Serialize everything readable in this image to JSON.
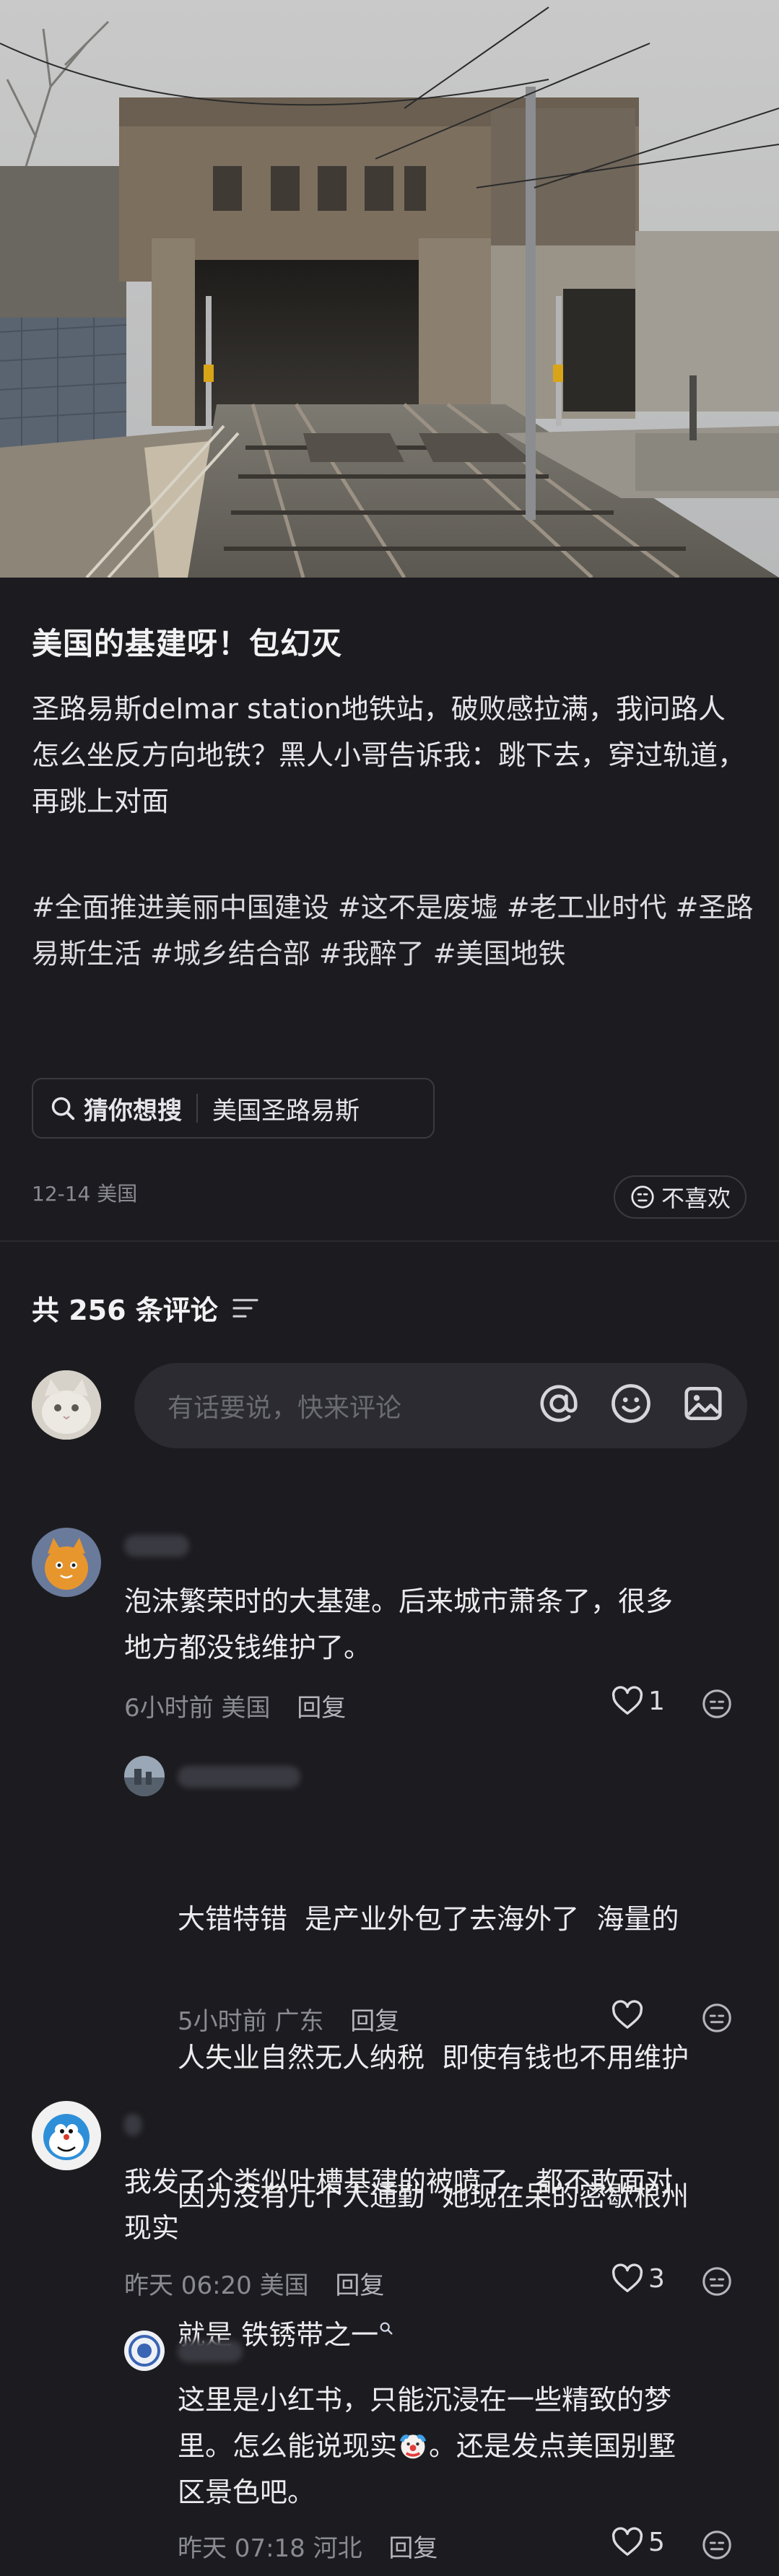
{
  "post": {
    "title": "美国的基建呀！包幻灭",
    "body": "圣路易斯delmar station地铁站，破败感拉满，我问路人怎么坐反方向地铁？黑人小哥告诉我：跳下去，穿过轨道，再跳上对面",
    "tags": [
      "#全面推进美丽中国建设",
      "#这不是废墟",
      "#老工业时代",
      "#圣路易斯生活",
      "#城乡结合部",
      "#我醉了",
      "#美国地铁"
    ],
    "search_chip": {
      "guess_label": "猜你想搜",
      "query": "美国圣路易斯"
    },
    "date": "12-14",
    "location": "美国",
    "dislike_label": "不喜欢"
  },
  "comments_section": {
    "header": "共 256 条评论",
    "input_placeholder": "有话要说，快来评论",
    "icons": [
      "at-icon",
      "emoji-icon",
      "image-icon"
    ]
  },
  "comments": [
    {
      "text_lines": [
        "泡沫繁荣时的大基建。后来城市萧条了，很多",
        "地方都没钱维护了。"
      ],
      "time": "6小时前",
      "location": "美国",
      "reply_label": "回复",
      "likes": "1",
      "reply": {
        "text_lines": [
          "大错特错  是产业外包了去海外了  海量的",
          "人失业自然无人纳税  即使有钱也不用维护",
          "因为没有几个人通勤  她现在呆的密歇根州",
          "就是 铁锈带之一"
        ],
        "time": "5小时前",
        "location": "广东",
        "reply_label": "回复",
        "likes": ""
      }
    },
    {
      "text_lines": [
        "我发了个类似吐槽基建的被喷了，都不敢面对",
        "现实"
      ],
      "time": "昨天 06:20",
      "location": "美国",
      "reply_label": "回复",
      "likes": "3",
      "reply": {
        "text_lines_a": [
          "这里是小红书，只能沉浸在一些精致的梦",
          "里。怎么能说现实"
        ],
        "text_line_a_tail": "。还是发点美国别墅",
        "text_lines_b": [
          "区景色吧。"
        ],
        "time": "昨天 07:18",
        "location": "河北",
        "reply_label": "回复",
        "likes": "5"
      }
    }
  ],
  "colors": {
    "background": "#1c1c20",
    "text": "#ececef",
    "muted": "#8a8a92"
  }
}
